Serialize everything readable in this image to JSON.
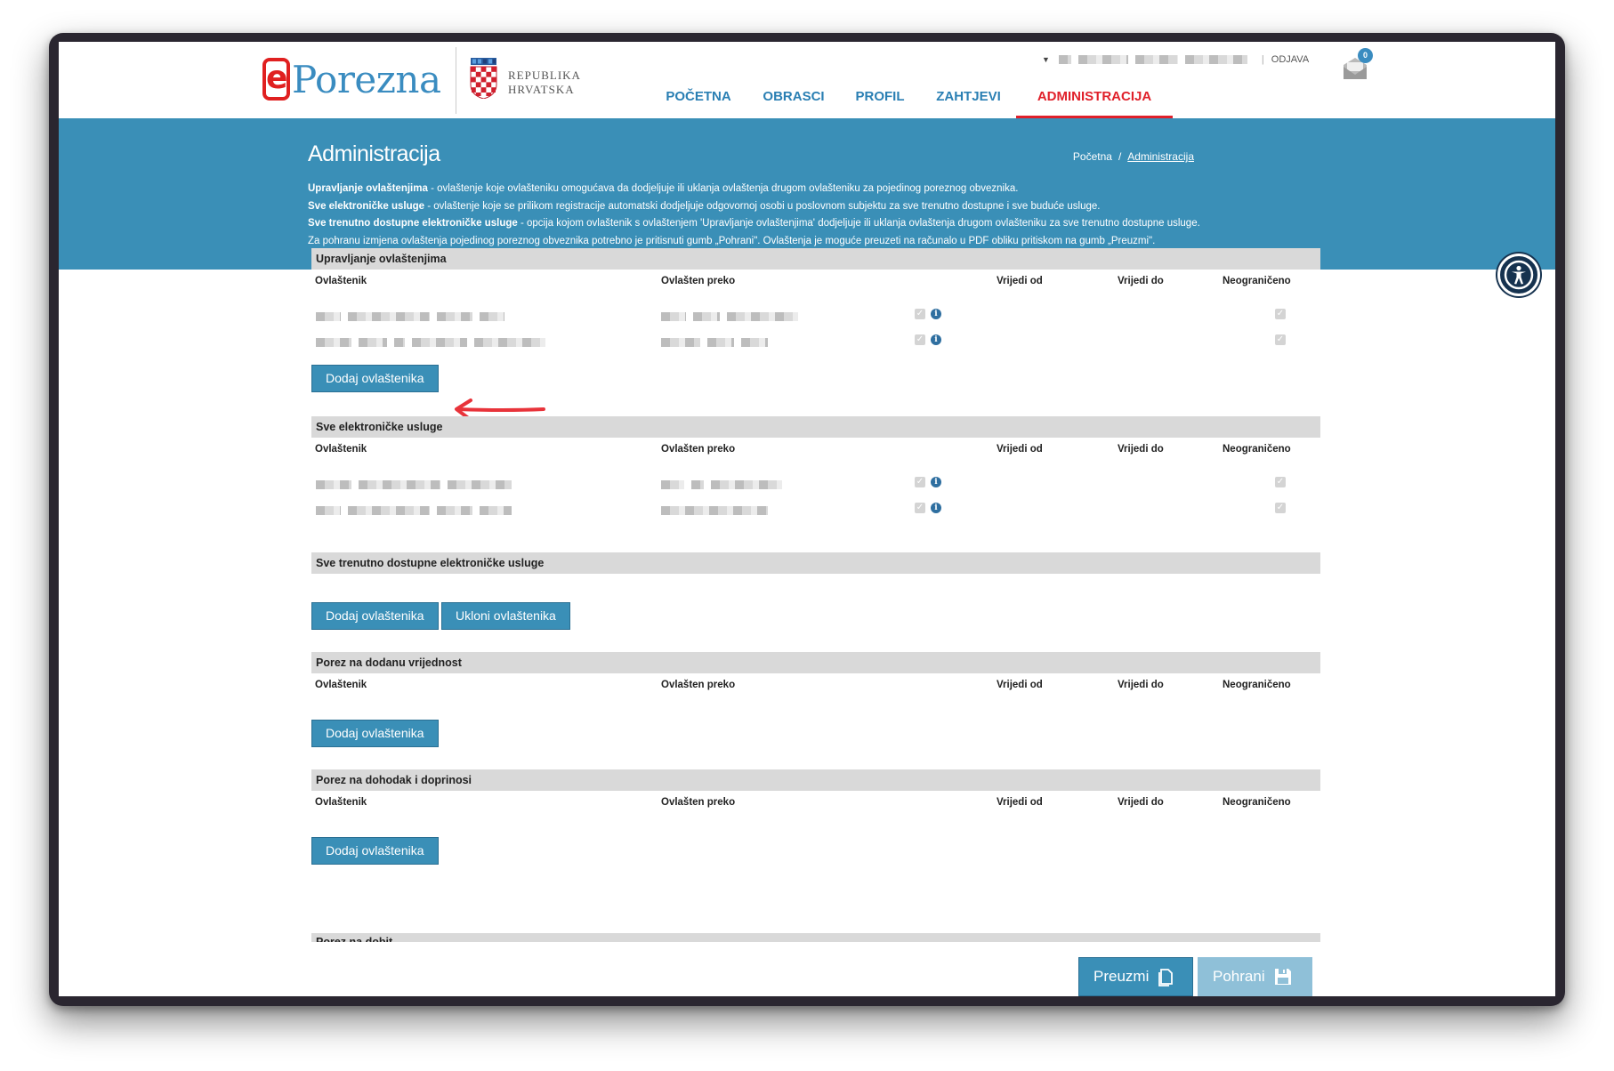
{
  "header": {
    "logo_text": "Porezna",
    "logo_e": "e",
    "republic_line1": "REPUBLIKA",
    "republic_line2": "HRVATSKA",
    "logout": "ODJAVA",
    "mail_count": "0",
    "nav": [
      {
        "label": "POČETNA"
      },
      {
        "label": "OBRASCI"
      },
      {
        "label": "PROFIL"
      },
      {
        "label": "ZAHTJEVI"
      },
      {
        "label": "ADMINISTRACIJA",
        "active": true
      }
    ]
  },
  "banner": {
    "title": "Administracija",
    "breadcrumb_home": "Početna",
    "breadcrumb_sep": "/",
    "breadcrumb_current": "Administracija",
    "info": [
      {
        "bold": "Upravljanje ovlaštenjima",
        "text": " - ovlaštenje koje ovlašteniku omogućava da dodjeljuje ili uklanja ovlaštenja drugom ovlašteniku za pojedinog poreznog obveznika."
      },
      {
        "bold": "Sve elektroničke usluge",
        "text": " - ovlaštenje koje se prilikom registracije automatski dodjeljuje odgovornoj osobi u poslovnom subjektu za sve trenutno dostupne i sve buduće usluge."
      },
      {
        "bold": "Sve trenutno dostupne elektroničke usluge",
        "text": " - opcija kojom ovlaštenik s ovlaštenjem 'Upravljanje ovlaštenjima' dodjeljuje ili uklanja ovlaštenja drugom ovlašteniku za sve trenutno dostupne usluge."
      },
      {
        "bold": "",
        "text": "Za pohranu izmjena ovlaštenja pojedinog poreznog obveznika potrebno je pritisnuti gumb „Pohrani\". Ovlaštenja je moguće preuzeti na računalo u PDF obliku pritiskom na gumb „Preuzmi\"."
      }
    ]
  },
  "columns": {
    "holder": "Ovlaštenik",
    "via": "Ovlašten preko",
    "valid_from": "Vrijedi od",
    "valid_to": "Vrijedi do",
    "unlimited": "Neograničeno"
  },
  "sections": {
    "upravljanje": {
      "title": "Upravljanje ovlaštenjima"
    },
    "sve_usluge": {
      "title": "Sve elektroničke usluge"
    },
    "trenutno": {
      "title": "Sve trenutno dostupne elektroničke usluge"
    },
    "pdv": {
      "title": "Porez na dodanu vrijednost"
    },
    "dohodak": {
      "title": "Porez na dohodak i doprinosi"
    },
    "dobit": {
      "title": "Porez na dobit"
    }
  },
  "buttons": {
    "add": "Dodaj ovlaštenika",
    "remove": "Ukloni ovlaštenika",
    "download": "Preuzmi",
    "save": "Pohrani"
  },
  "colors": {
    "primary": "#3a8fb7",
    "active_nav": "#e0202a",
    "annotation_arrow": "#e8333a"
  }
}
